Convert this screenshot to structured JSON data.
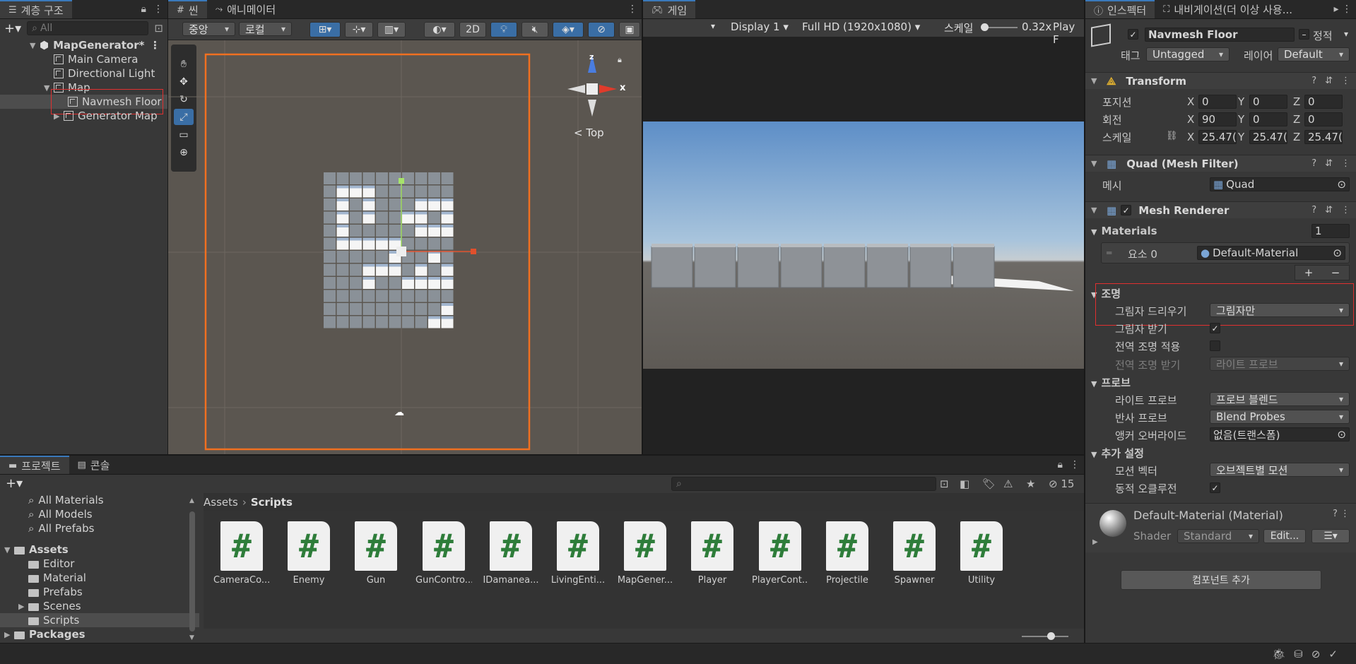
{
  "hierarchy": {
    "tab": "계층 구조",
    "search_placeholder": "All",
    "scene": "MapGenerator*",
    "items": [
      "Main Camera",
      "Directional Light",
      "Map",
      "Navmesh Floor",
      "Generator Map"
    ]
  },
  "scene_view": {
    "tabs": [
      "씬",
      "애니메이터"
    ],
    "pivot": "중앙",
    "space": "로컬",
    "mode_2d": "2D",
    "gizmo_label": "Top",
    "gizmo_z": "z",
    "gizmo_x": "x"
  },
  "game_view": {
    "tab": "게임",
    "display": "Display 1",
    "resolution": "Full HD (1920x1080)",
    "scale_label": "스케일",
    "scale_value": "0.32x",
    "play": "Play F"
  },
  "inspector": {
    "tabs": [
      "인스펙터",
      "내비게이션(더 이상 사용..."
    ],
    "object_name": "Navmesh Floor",
    "static_label": "정적",
    "tag_label": "태그",
    "tag_value": "Untagged",
    "layer_label": "레이어",
    "layer_value": "Default",
    "transform": {
      "title": "Transform",
      "position_label": "포지션",
      "rotation_label": "회전",
      "scale_label": "스케일",
      "axes": [
        "X",
        "Y",
        "Z"
      ],
      "position": [
        "0",
        "0",
        "0"
      ],
      "rotation": [
        "90",
        "0",
        "0"
      ],
      "scale": [
        "25.47(",
        "25.47(",
        "25.47("
      ]
    },
    "mesh_filter": {
      "title": "Quad (Mesh Filter)",
      "mesh_label": "메시",
      "mesh_value": "Quad"
    },
    "mesh_renderer": {
      "title": "Mesh Renderer",
      "materials_label": "Materials",
      "materials_count": "1",
      "element_label": "요소 0",
      "element_value": "Default-Material",
      "lighting_label": "조명",
      "cast_shadows_label": "그림자 드리우기",
      "cast_shadows_value": "그림자만",
      "receive_shadows_label": "그림자 받기",
      "gi_label": "전역 조명 적용",
      "receive_gi_label": "전역 조명 받기",
      "receive_gi_value": "라이트 프로브",
      "probes_label": "프로브",
      "light_probe_label": "라이트 프로브",
      "light_probe_value": "프로브 블렌드",
      "reflection_probe_label": "반사 프로브",
      "reflection_probe_value": "Blend Probes",
      "anchor_label": "앵커 오버라이드",
      "anchor_value": "없음(트랜스폼)",
      "additional_label": "추가 설정",
      "motion_label": "모션 벡터",
      "motion_value": "오브젝트별 모션",
      "occlusion_label": "동적 오클루전"
    },
    "material": {
      "title": "Default-Material (Material)",
      "shader_label": "Shader",
      "shader_value": "Standard",
      "edit": "Edit..."
    },
    "add_component": "컴포넌트 추가"
  },
  "project": {
    "tabs": [
      "프로젝트",
      "콘솔"
    ],
    "badge_count": "15",
    "tree": [
      "All Materials",
      "All Models",
      "All Prefabs",
      "Assets",
      "Editor",
      "Material",
      "Prefabs",
      "Scenes",
      "Scripts",
      "Packages"
    ],
    "breadcrumb": [
      "Assets",
      "Scripts"
    ],
    "files": [
      "CameraCo...",
      "Enemy",
      "Gun",
      "GunContro...",
      "IDamanea...",
      "LivingEnti...",
      "MapGener...",
      "Player",
      "PlayerCont...",
      "Projectile",
      "Spawner",
      "Utility"
    ]
  },
  "colors": {
    "accent": "#3a79bb",
    "highlight": "#e03030",
    "selection_orange": "#f07020"
  }
}
